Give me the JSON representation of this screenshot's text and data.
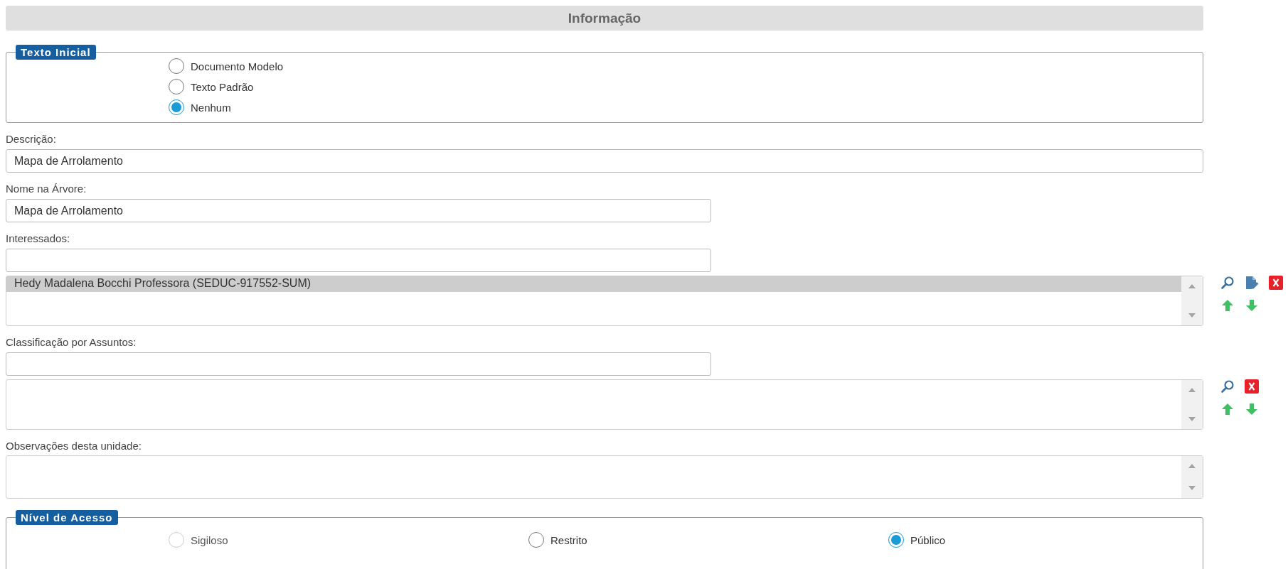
{
  "header": {
    "title": "Informação"
  },
  "texto_inicial": {
    "legend": "Texto Inicial",
    "options": [
      {
        "label": "Documento Modelo",
        "selected": false,
        "disabled": false
      },
      {
        "label": "Texto Padrão",
        "selected": false,
        "disabled": false
      },
      {
        "label": "Nenhum",
        "selected": true,
        "disabled": false
      }
    ]
  },
  "descricao": {
    "label": "Descrição:",
    "value": "Mapa de Arrolamento"
  },
  "nome_na_arvore": {
    "label": "Nome na Árvore:",
    "value": "Mapa de Arrolamento"
  },
  "interessados": {
    "label": "Interessados:",
    "items": [
      {
        "text": "Hedy Madalena Bocchi Professora (SEDUC-917552-SUM)",
        "selected": true
      }
    ],
    "edit_button": true
  },
  "classificacao": {
    "label": "Classificação por Assuntos:"
  },
  "observacoes": {
    "label": "Observações desta unidade:"
  },
  "nivel_de_acesso": {
    "legend": "Nível de Acesso",
    "options": [
      {
        "label": "Sigiloso",
        "selected": false,
        "disabled": true
      },
      {
        "label": "Restrito",
        "selected": false,
        "disabled": false
      },
      {
        "label": "Público",
        "selected": true,
        "disabled": false
      }
    ]
  }
}
